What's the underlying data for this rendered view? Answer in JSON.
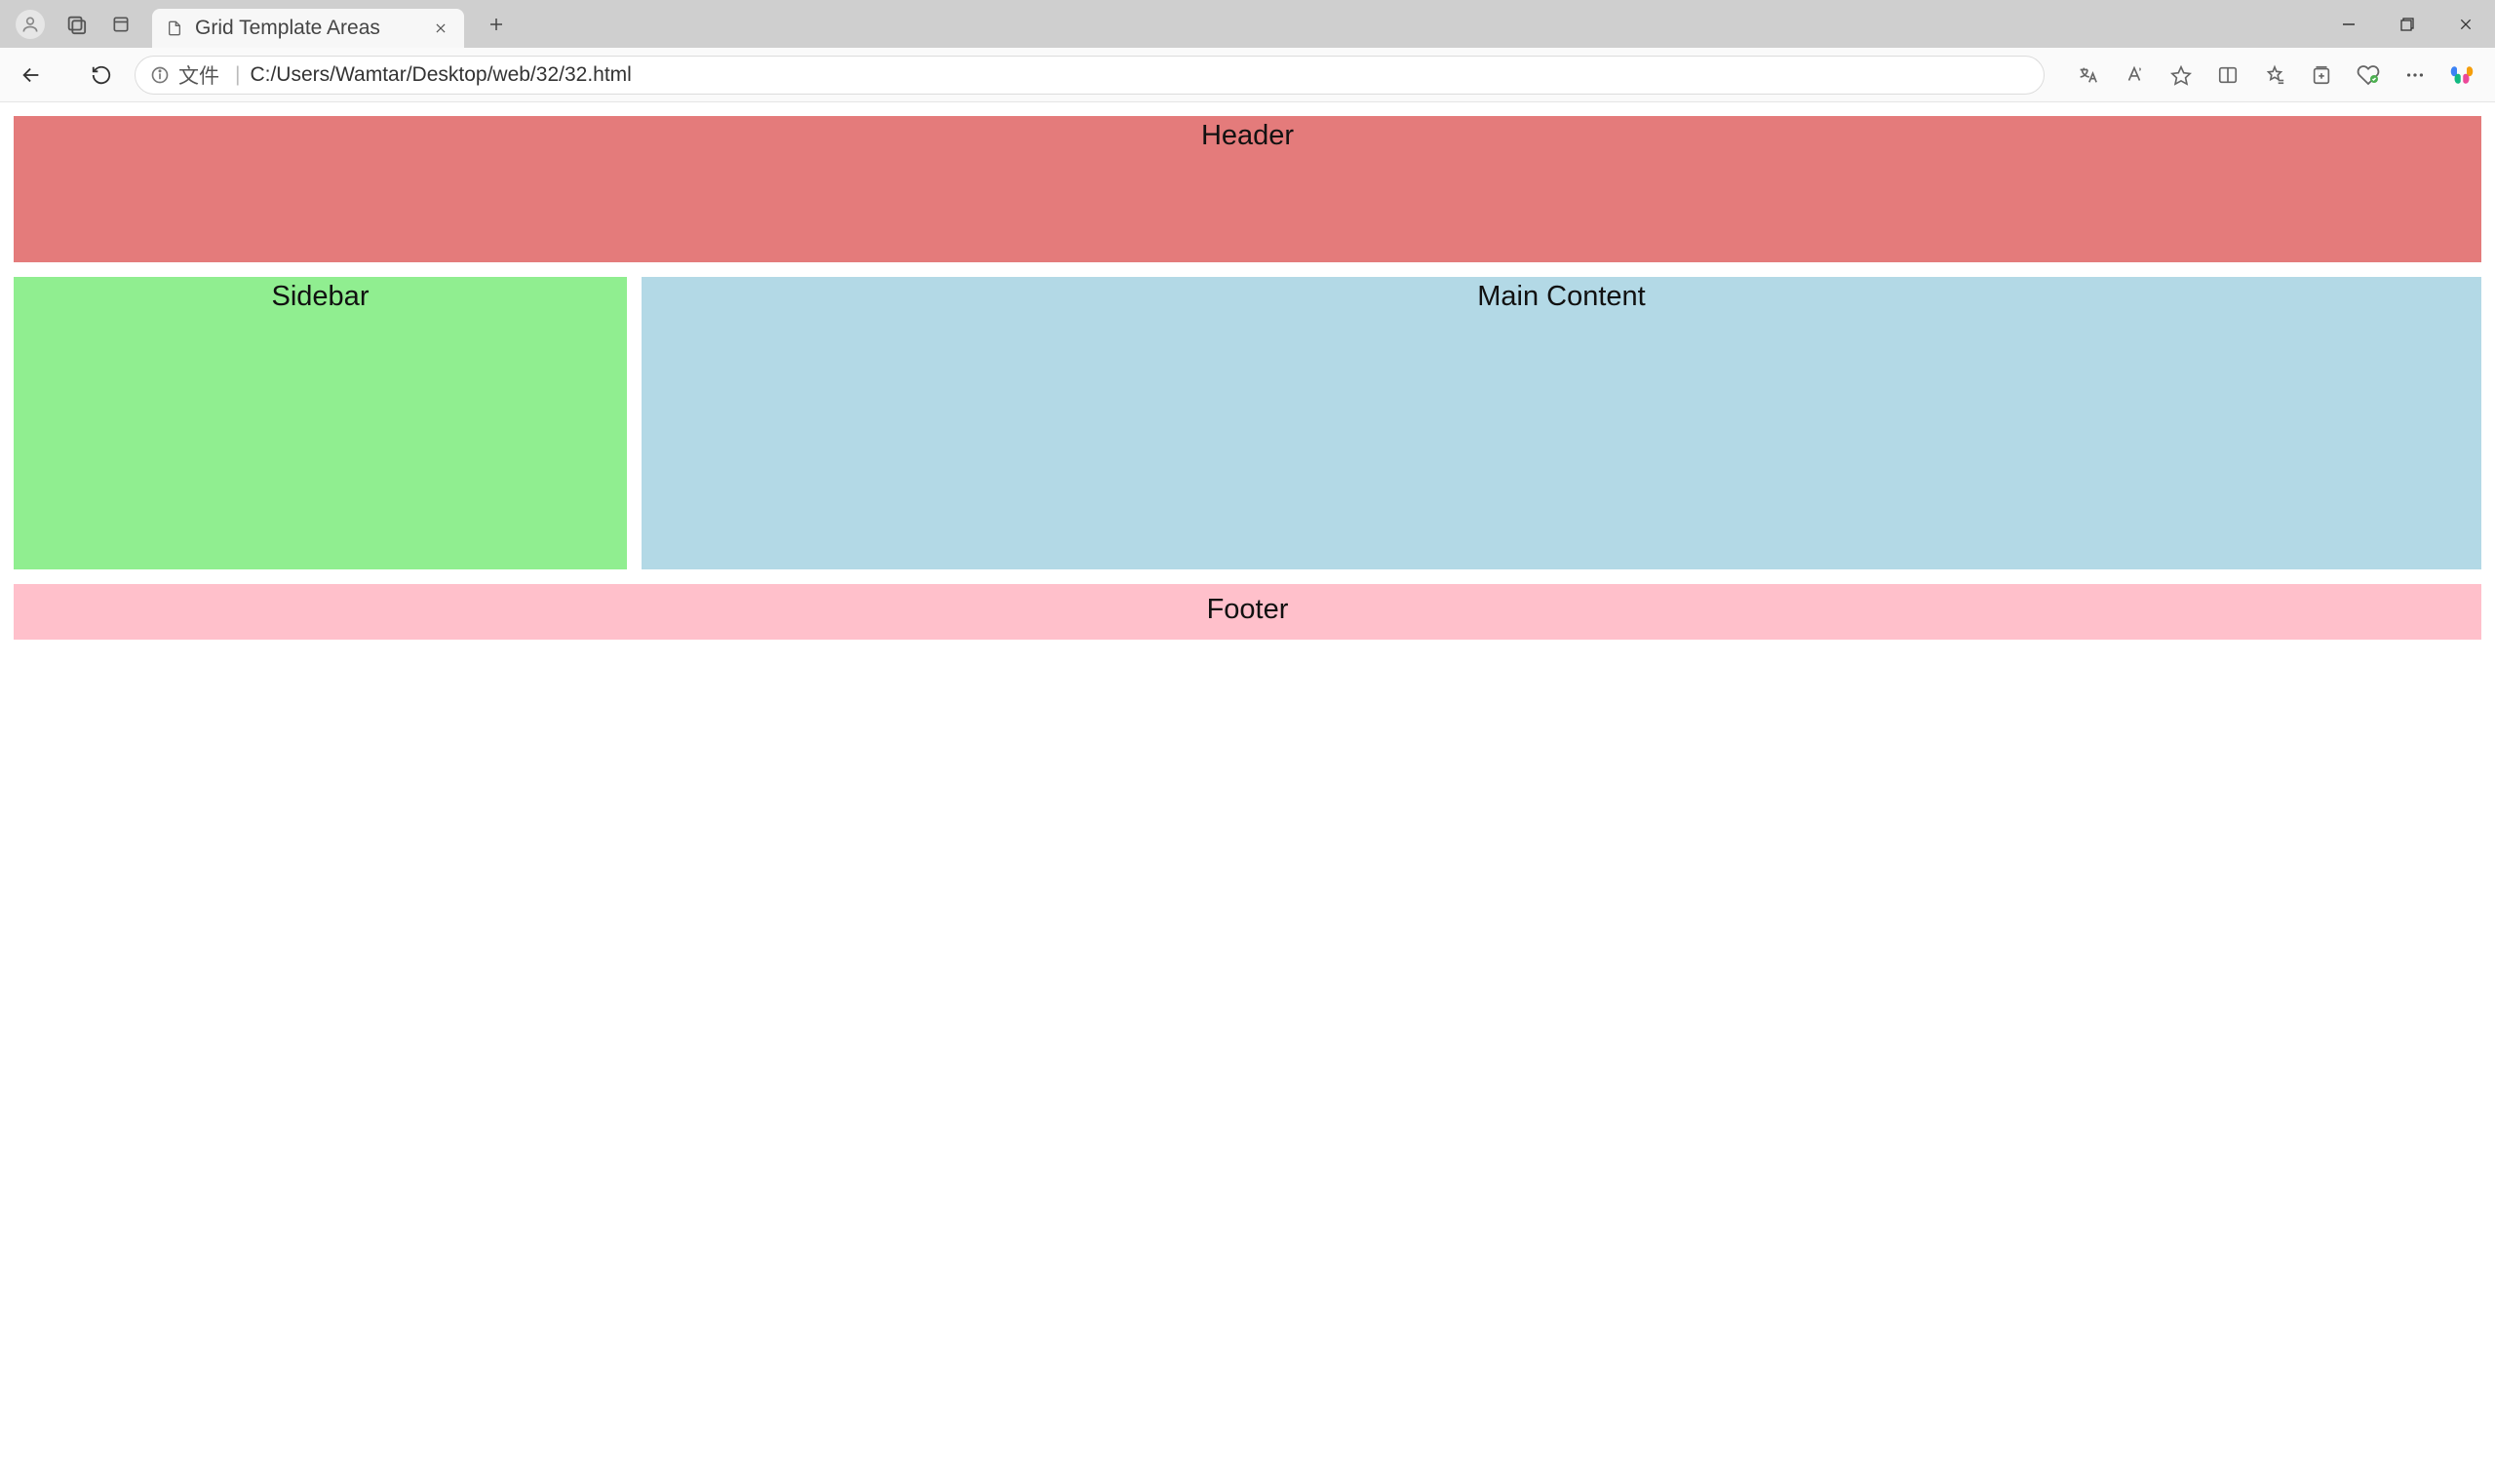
{
  "browser": {
    "tab": {
      "title": "Grid Template Areas"
    },
    "address": {
      "prefix": "文件",
      "url": "C:/Users/Wamtar/Desktop/web/32/32.html"
    }
  },
  "page": {
    "header": "Header",
    "sidebar": "Sidebar",
    "main": "Main Content",
    "footer": "Footer"
  },
  "colors": {
    "header": "#e47b7b",
    "sidebar": "#90ee90",
    "main": "#b3d9e6",
    "footer": "#ffc0cb"
  }
}
